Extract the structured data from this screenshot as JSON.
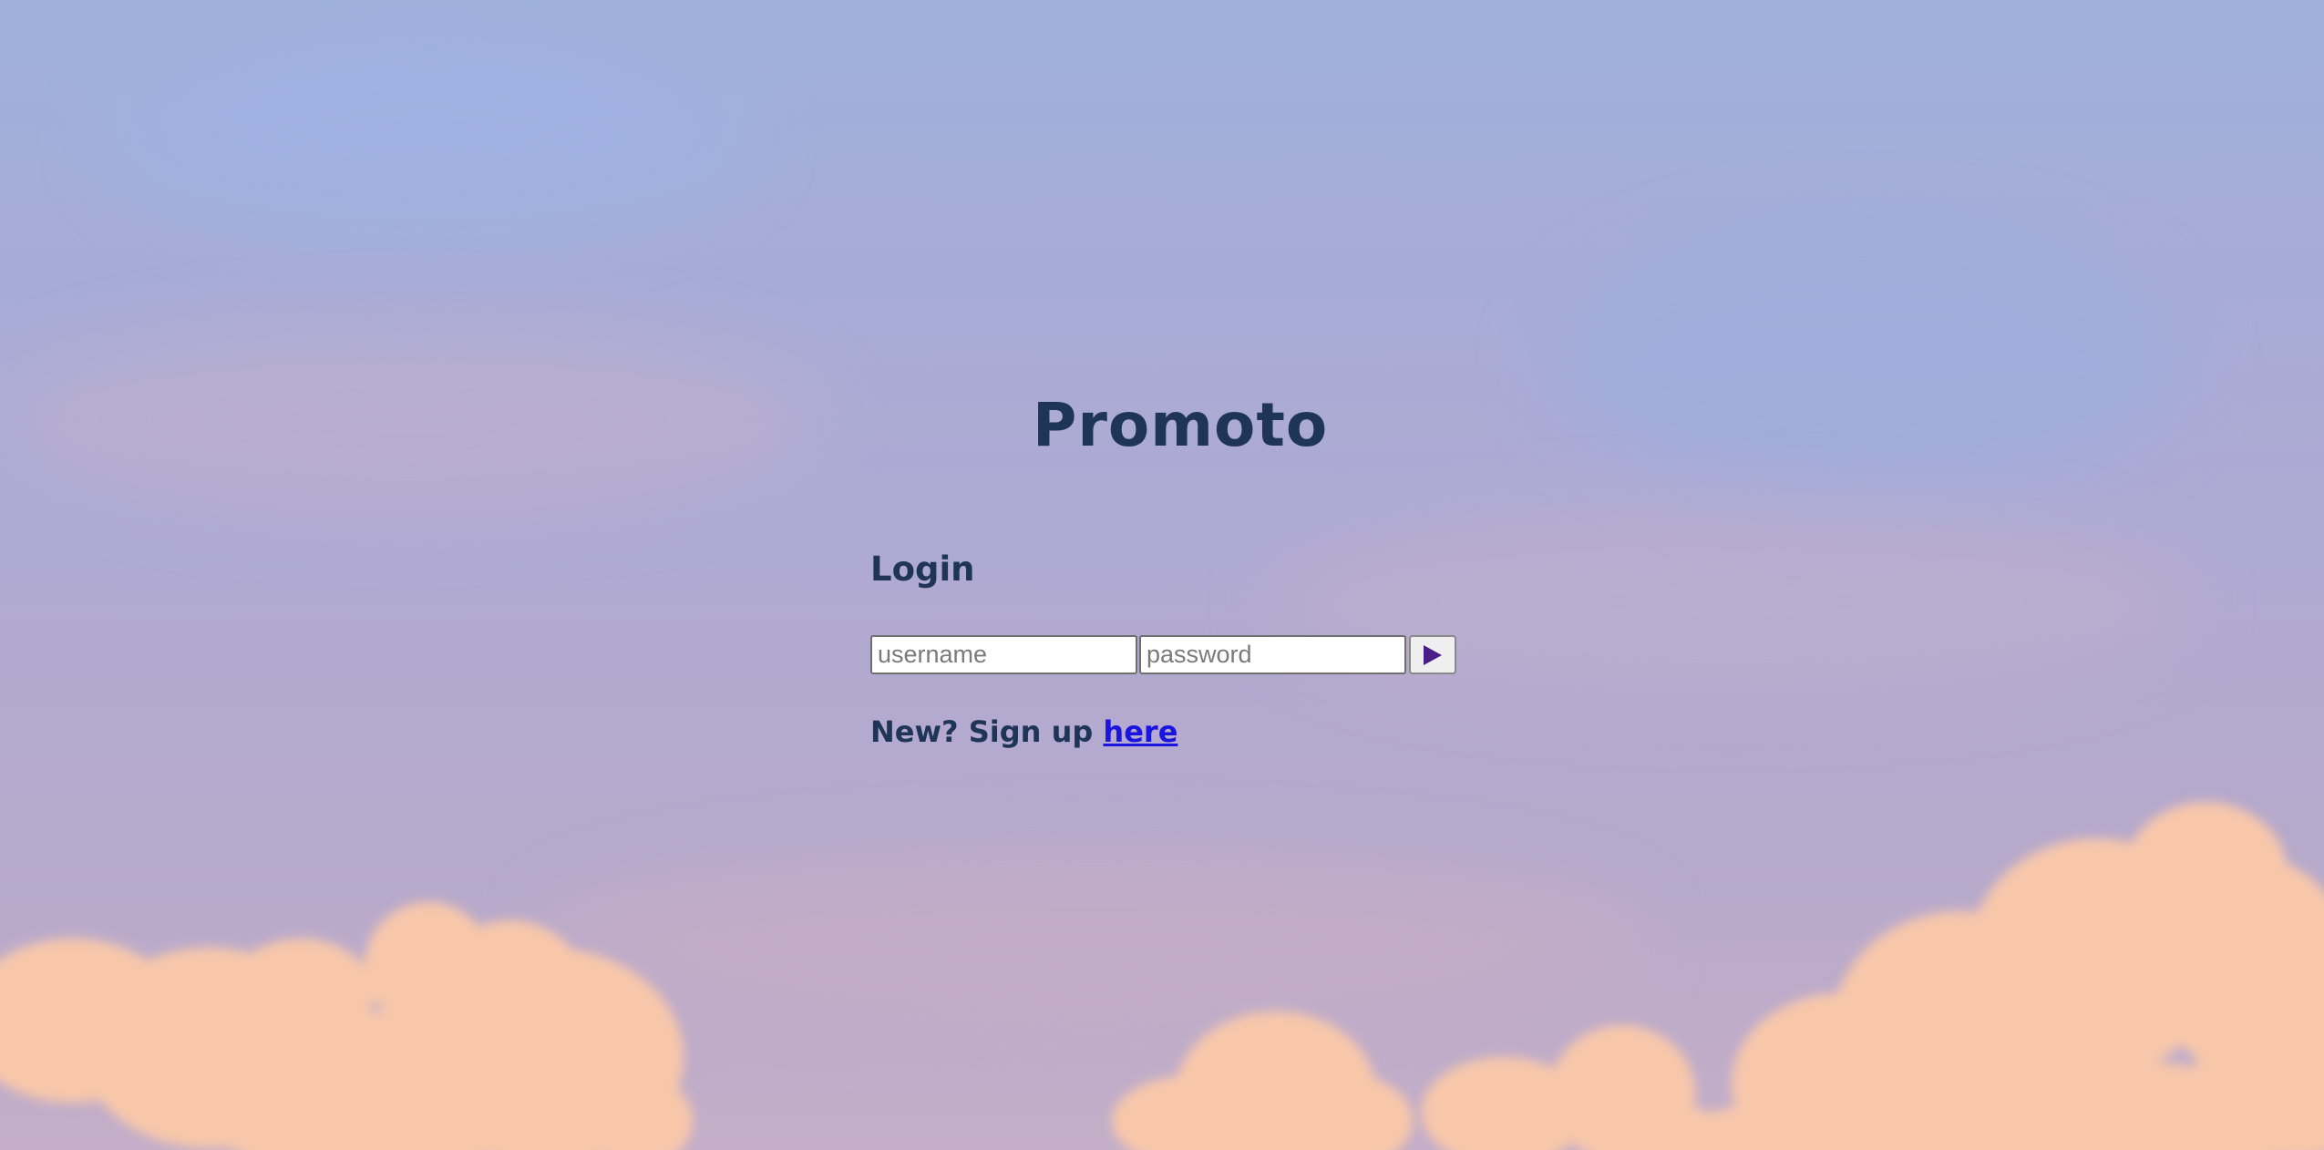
{
  "app": {
    "title": "Promoto"
  },
  "login": {
    "heading": "Login",
    "username_placeholder": "username",
    "password_placeholder": "password",
    "submit_icon": "play-triangle-icon"
  },
  "signup": {
    "prompt": "New? Sign up",
    "link_label": "here"
  },
  "colors": {
    "text_primary": "#1f3557",
    "link": "#1a14e0",
    "submit_icon": "#4a1f8a",
    "cloud": "#f8c7aa"
  }
}
